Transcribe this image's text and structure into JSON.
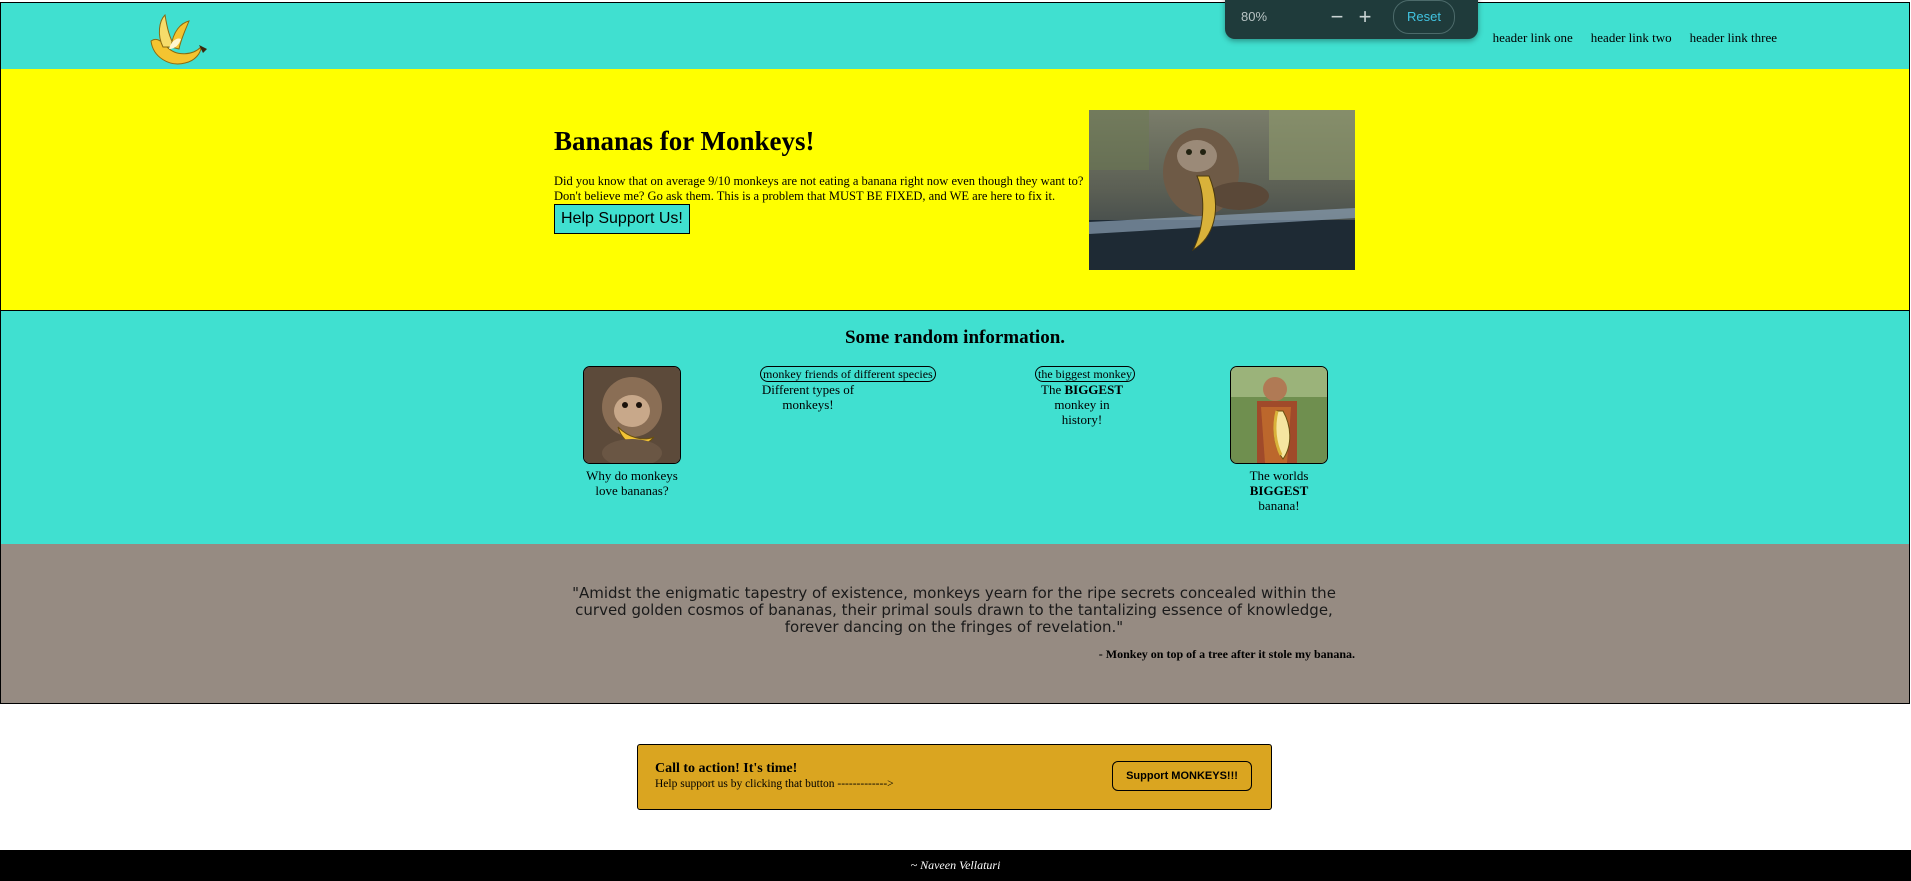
{
  "header": {
    "logo_icon": "banana-logo-icon",
    "links": [
      "header link one",
      "header link two",
      "header link three"
    ]
  },
  "zoom_popup": {
    "level": "80%",
    "zoom_out_symbol": "−",
    "zoom_in_symbol": "+",
    "reset_label": "Reset"
  },
  "hero": {
    "title": "Bananas for Monkeys!",
    "description": "Did you know that on average 9/10 monkeys are not eating a banana right now even though they want to? Don't believe me? Go ask them. This is a problem that MUST BE FIXED, and WE are here to fix it.",
    "button_label": "Help Support Us!",
    "image_icon": "monkey-eating-banana-photo"
  },
  "info": {
    "title": "Some random information.",
    "cards": [
      {
        "caption": "Why do monkeys love bananas?"
      },
      {
        "alt": "monkey friends of different species",
        "caption": "Different types of monkeys!"
      },
      {
        "alt": "the biggest monkey",
        "caption_pre": "The ",
        "caption_bold": "BIGGEST",
        "caption_post": " monkey in history!"
      },
      {
        "caption_pre": "The worlds ",
        "caption_bold": "BIGGEST",
        "caption_post": " banana!"
      }
    ]
  },
  "quote": {
    "text": "\"Amidst the enigmatic tapestry of existence, monkeys yearn for the ripe secrets concealed within the curved golden cosmos of bananas, their primal souls drawn to the tantalizing essence of knowledge, forever dancing on the fringes of revelation.\"",
    "attribution": "- Monkey on top of a tree after it stole my banana."
  },
  "call_to_action": {
    "title": "Call to action! It's time!",
    "subtitle": "Help support us by clicking that button ------------->",
    "button_label": "Support MONKEYS!!!"
  },
  "footer": {
    "credit": "~ Naveen Vellaturi"
  },
  "colors": {
    "turquoise": "#40e0d0",
    "yellow": "#ffff00",
    "taupe": "#968b82",
    "goldenrod": "#daa520"
  }
}
